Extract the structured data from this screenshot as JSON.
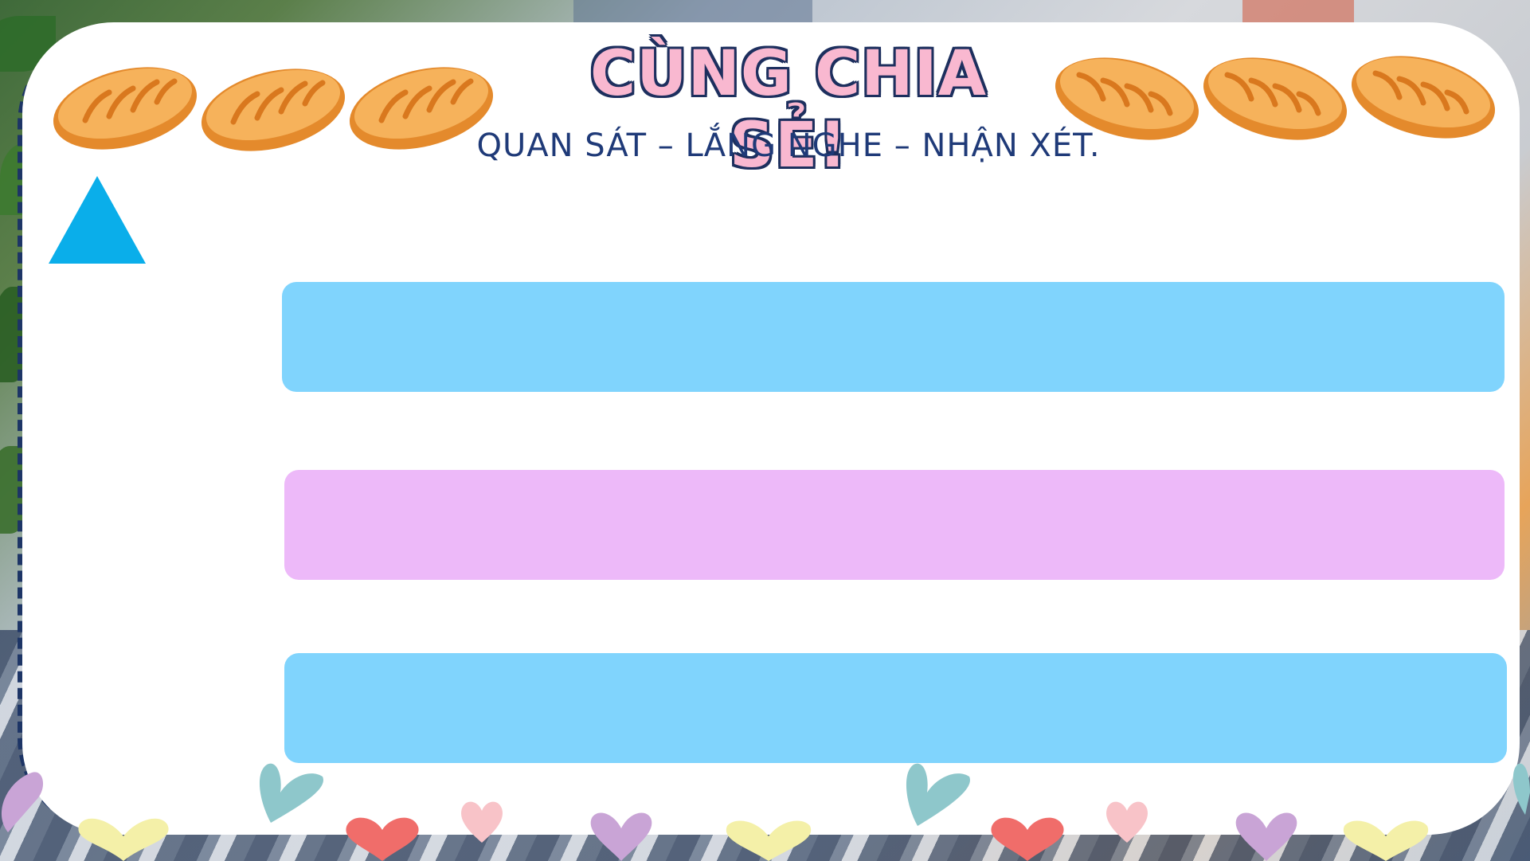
{
  "slide": {
    "title": "CÙNG CHIA SẺ!",
    "subtitle": "QUAN SÁT – LẮNG NGHE – NHẬN XÉT."
  },
  "decorations": {
    "bread_icon": "bread-loaf-icon",
    "heart_icon": "heart-icon",
    "triangle_color": "#0aaeea"
  },
  "bars": [
    {
      "color": "#80d4fd"
    },
    {
      "color": "#edb9f9"
    },
    {
      "color": "#80d4fd"
    }
  ]
}
